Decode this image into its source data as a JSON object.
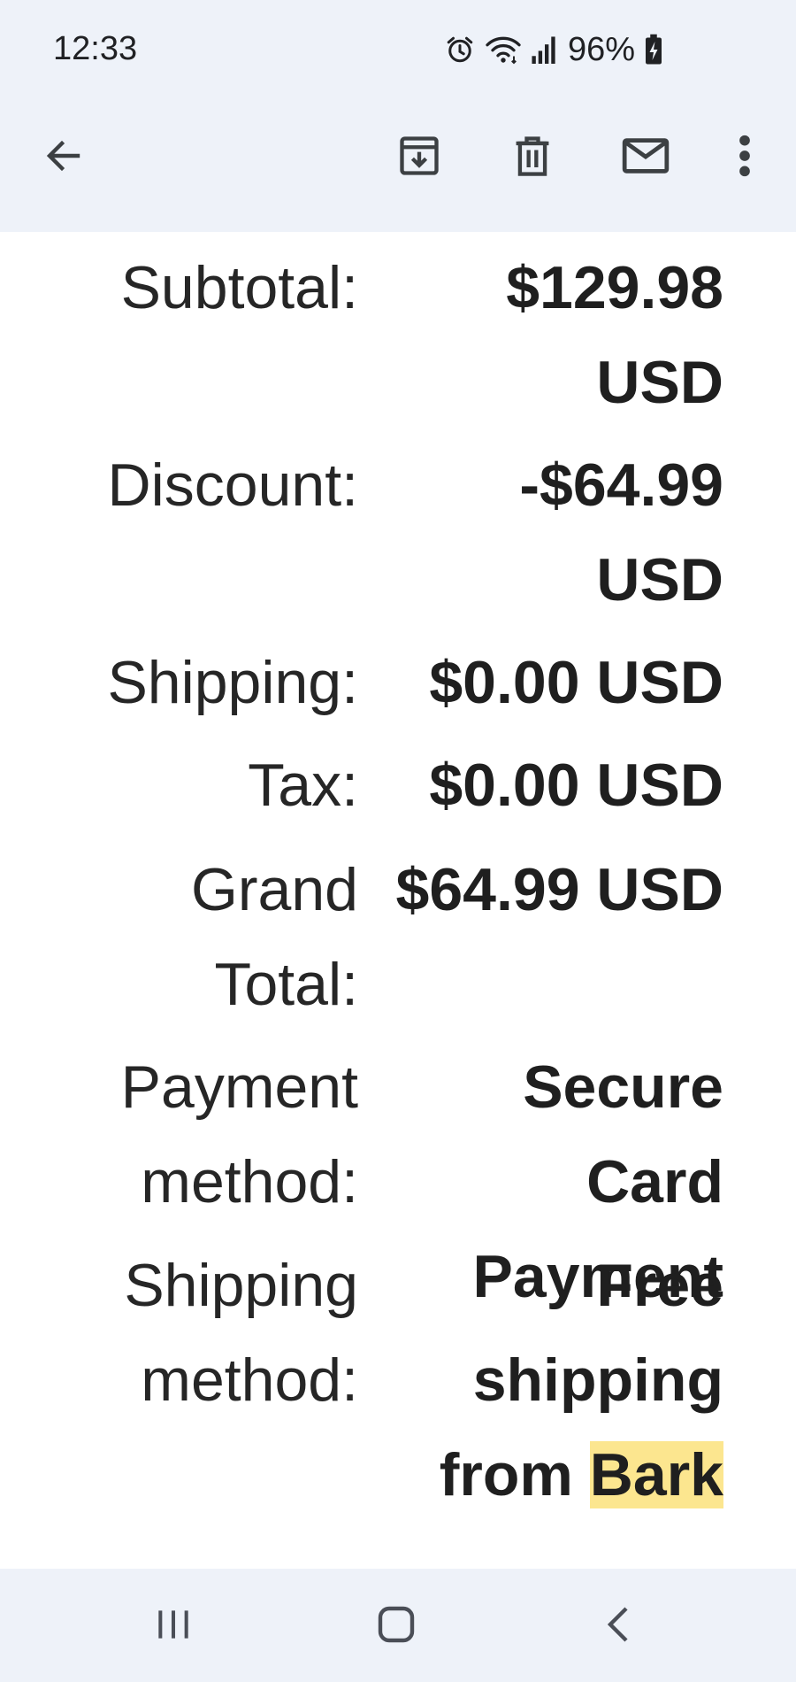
{
  "status_bar": {
    "time": "12:33",
    "battery": "96%",
    "icons": [
      "alarm-icon",
      "wifi-icon",
      "signal-icon",
      "battery-charging-icon"
    ]
  },
  "toolbar": {
    "icons": [
      "back-arrow-icon",
      "archive-icon",
      "trash-icon",
      "mail-icon",
      "more-vert-icon"
    ]
  },
  "summary": {
    "subtotal": {
      "label": "Subtotal:",
      "value_line1": "$129.98",
      "value_line2": "USD"
    },
    "discount": {
      "label": "Discount:",
      "value_line1": "-$64.99",
      "value_line2": "USD"
    },
    "shipping": {
      "label": "Shipping:",
      "value": "$0.00 USD"
    },
    "tax": {
      "label": "Tax:",
      "value": "$0.00 USD"
    },
    "grand_total": {
      "label_line1": "Grand",
      "label_line2": "Total:",
      "value": "$64.99 USD"
    },
    "payment_method": {
      "label_line1": "Payment",
      "label_line2": "method:",
      "value_line1": "Secure Card",
      "value_line2": "Payment"
    },
    "shipping_method": {
      "label_line1": "Shipping",
      "label_line2": "method:",
      "value_line1": "Free",
      "value_line2": "shipping",
      "value_line3_prefix": "from ",
      "value_line3_highlight": "Bark"
    }
  },
  "nav": {
    "icons": [
      "recent-apps-icon",
      "home-icon",
      "back-icon"
    ]
  },
  "colors": {
    "bar_background": "#eef2f9",
    "highlight": "#fce68f",
    "text": "#1f1f1f"
  }
}
